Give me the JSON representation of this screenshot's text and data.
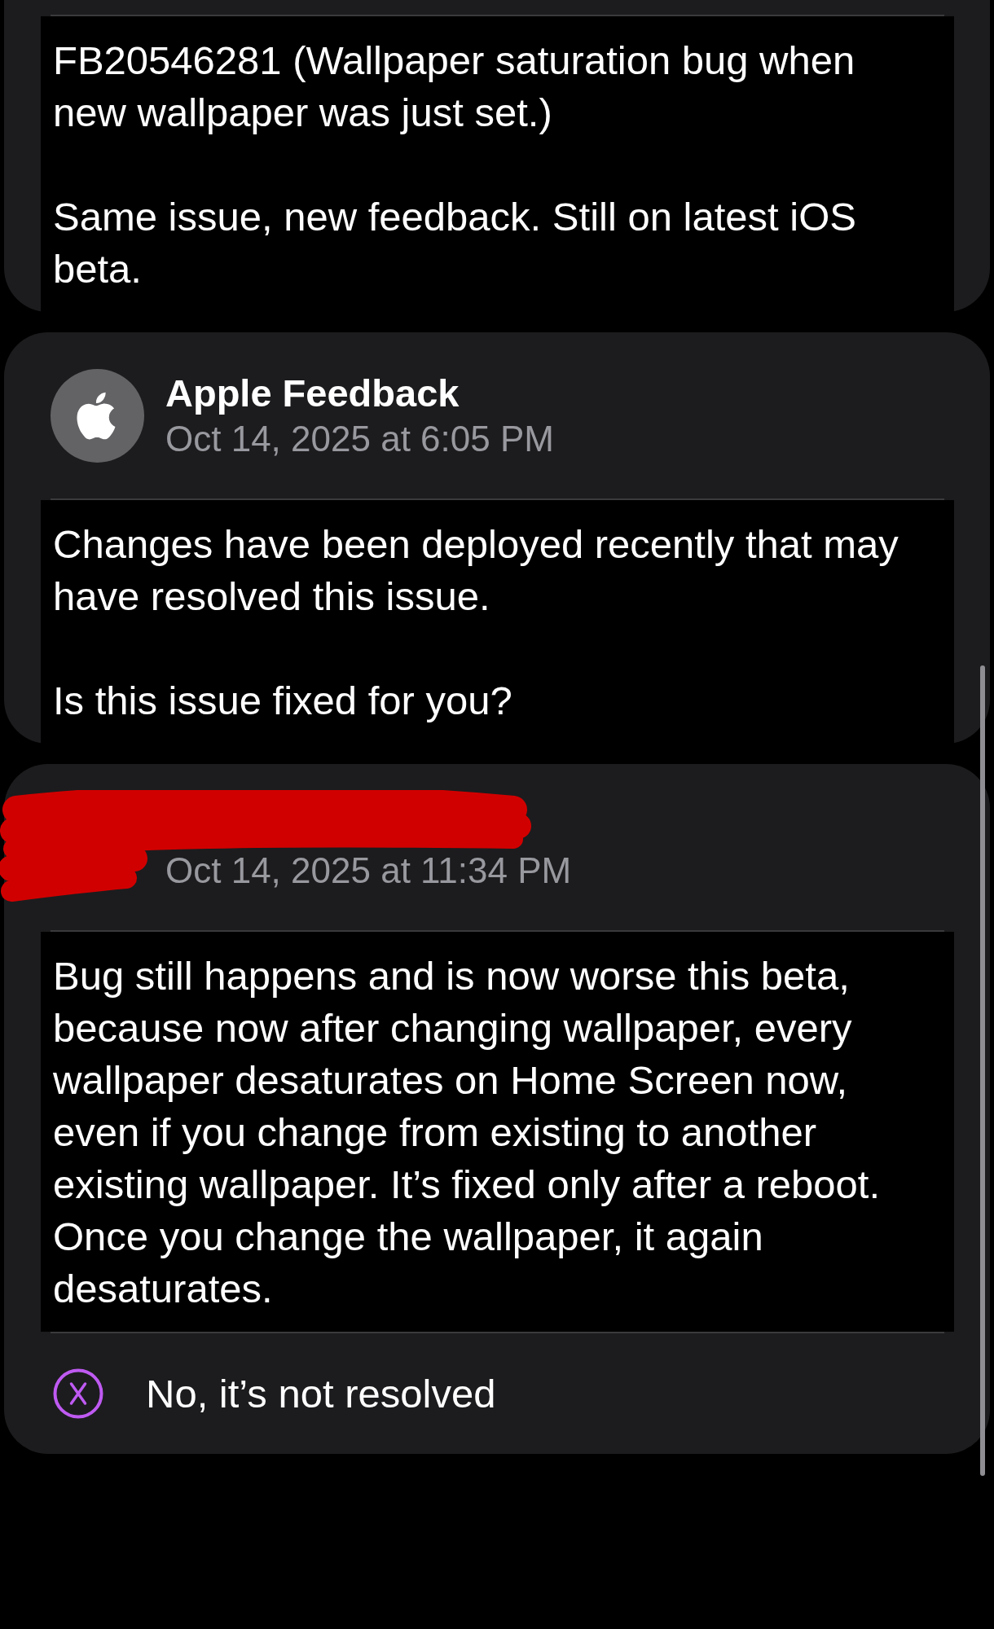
{
  "messages": [
    {
      "paragraphs": [
        "FB20546281 (Wallpaper saturation bug when new wallpaper was just set.)",
        "Same issue, new feedback. Still on latest iOS beta."
      ]
    },
    {
      "author": {
        "name": "Apple Feedback",
        "avatar": {
          "kind": "apple"
        }
      },
      "date": "Oct 14, 2025 at 6:05 PM",
      "paragraphs": [
        "Changes have been deployed recently that may have resolved this issue.",
        "Is this issue fixed for you?"
      ]
    },
    {
      "author": {
        "redacted": true
      },
      "date": "Oct 14, 2025 at 11:34 PM",
      "paragraphs": [
        "Bug still happens and is now worse this beta, because now after changing wallpaper, every wallpaper desaturates on Home Screen now, even if you change from existing to another existing wallpaper. It’s fixed only after a reboot. Once you change the wallpaper, it again desaturates."
      ],
      "resolution": {
        "kind": "not_resolved",
        "label": "No, it’s not resolved"
      }
    }
  ]
}
